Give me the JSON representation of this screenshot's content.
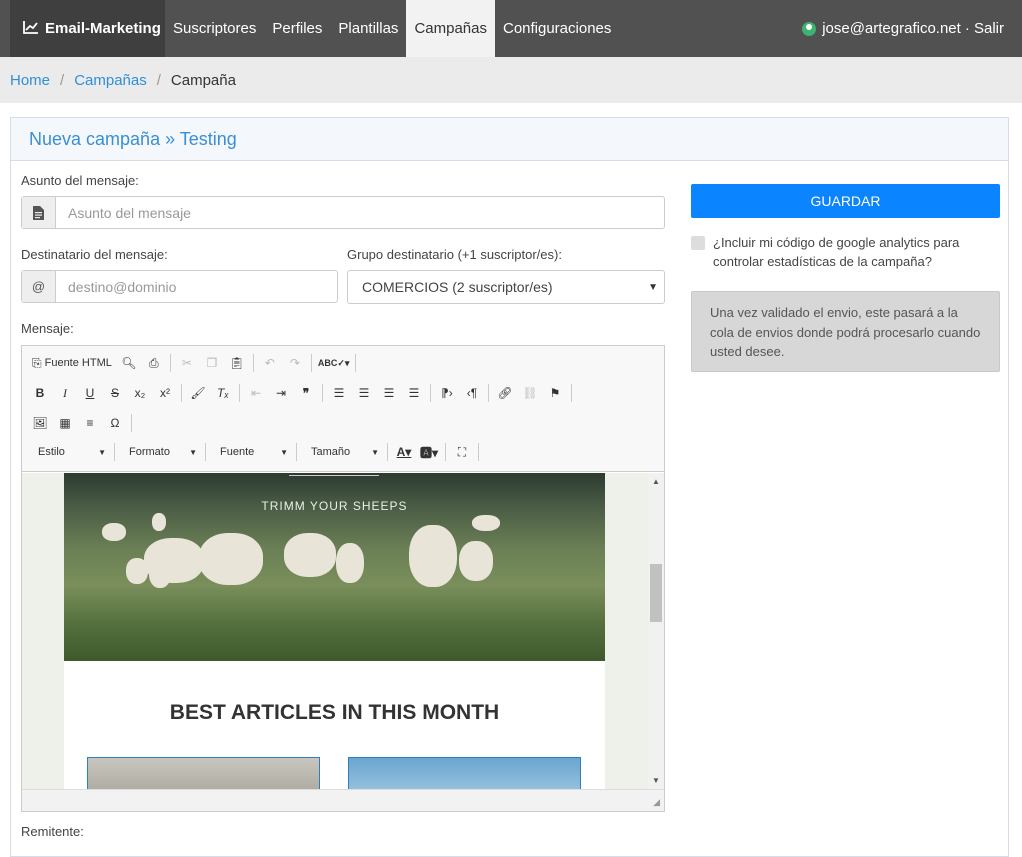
{
  "nav": {
    "brand": "Email-Marketing",
    "links": [
      "Suscriptores",
      "Perfiles",
      "Plantillas",
      "Campañas",
      "Configuraciones"
    ],
    "active": "Campañas",
    "user": "jose@artegrafico.net",
    "logout": "· Salir"
  },
  "breadcrumb": {
    "home": "Home",
    "campaigns": "Campañas",
    "current": "Campaña"
  },
  "card": {
    "title": "Nueva campaña » Testing"
  },
  "form": {
    "subject_label": "Asunto del mensaje:",
    "subject_placeholder": "Asunto del mensaje",
    "recipient_label": "Destinatario del mensaje:",
    "recipient_placeholder": "destino@dominio",
    "recipient_addon": "@",
    "group_label": "Grupo destinatario (+1 suscriptor/es):",
    "group_value": "COMERCIOS (2 suscriptor/es)",
    "message_label": "Mensaje:",
    "sender_label": "Remitente:"
  },
  "editor": {
    "source_label": "Fuente HTML",
    "combos": [
      "Estilo",
      "Formato",
      "Fuente",
      "Tamaño"
    ],
    "content": {
      "caption": "TRIMM YOUR SHEEPS",
      "heading": "BEST ARTICLES IN THIS MONTH"
    }
  },
  "sidebar": {
    "save_label": "GUARDAR",
    "analytics_text": "¿Incluir mi código de google analytics para controlar estadísticas de la campaña?",
    "info_text": "Una vez validado el envio, este pasará a la cola de envios donde podrá procesarlo cuando usted desee."
  },
  "colors": {
    "primary": "#0a84ff",
    "nav": "#515151",
    "link": "#2f8fd8"
  }
}
